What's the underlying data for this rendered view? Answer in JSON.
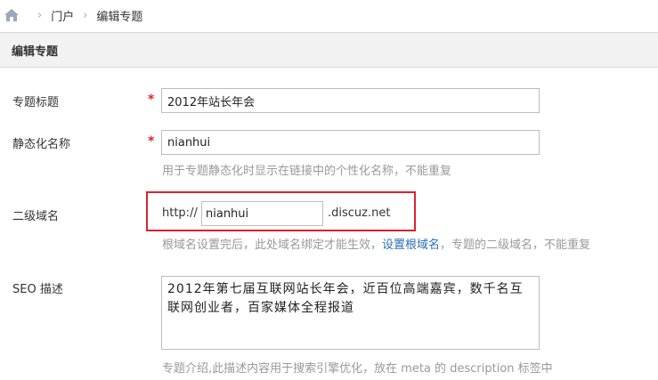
{
  "breadcrumb": {
    "items": [
      "门户",
      "编辑专题"
    ]
  },
  "panel": {
    "title": "编辑专题"
  },
  "fields": {
    "title": {
      "label": "专题标题",
      "required_mark": "*",
      "value": "2012年站长年会"
    },
    "static_name": {
      "label": "静态化名称",
      "required_mark": "*",
      "value": "nianhui",
      "hint": "用于专题静态化时显示在链接中的个性化名称，不能重复"
    },
    "subdomain": {
      "label": "二级域名",
      "prefix": "http://",
      "value": "nianhui",
      "suffix": ".discuz.net",
      "hint_before": "根域名设置完后，此处域名绑定才能生效，",
      "hint_link": "设置根域名",
      "hint_after": "，专题的二级域名，不能重复"
    },
    "seo_description": {
      "label": "SEO 描述",
      "value": "2012年第七届互联网站长年会，近百位高端嘉宾，数千名互联网创业者，百家媒体全程报道",
      "hint": "专题介绍,此描述内容用于搜索引擎优化，放在 meta 的 description 标签中"
    }
  },
  "colors": {
    "required": "#e0232a",
    "highlight_box": "#d9232d",
    "link": "#2a6fb4",
    "hint": "#999999",
    "header_bg": "#f2f2f2"
  }
}
